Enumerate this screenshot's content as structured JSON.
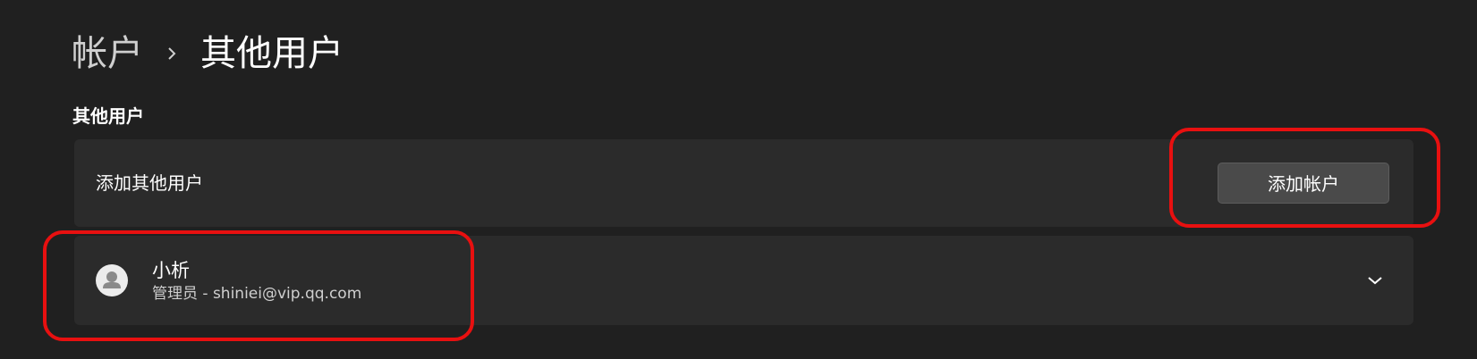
{
  "breadcrumb": {
    "parent": "帐户",
    "current": "其他用户"
  },
  "section": {
    "title": "其他用户"
  },
  "add_user_card": {
    "label": "添加其他用户",
    "button_label": "添加帐户"
  },
  "users": [
    {
      "name": "小析",
      "role": "管理员",
      "email": "shiniei@vip.qq.com",
      "subtitle": "管理员 - shiniei@vip.qq.com"
    }
  ],
  "icons": {
    "breadcrumb_separator": "chevron-right-icon",
    "avatar": "user-avatar-icon",
    "expand": "chevron-down-icon"
  },
  "colors": {
    "background": "#202020",
    "card": "#2b2b2b",
    "button": "#4a4a4a",
    "highlight": "#e81010"
  }
}
